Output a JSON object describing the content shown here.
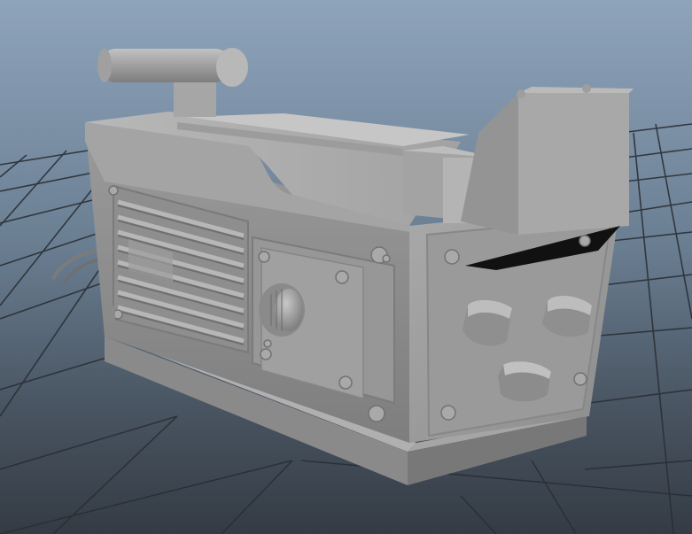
{
  "viewport": {
    "background_top": "#8ea4bb",
    "background_bottom": "#343b44",
    "grid_color": "#2a2f35"
  },
  "model": {
    "material_color": "#9a9a9a",
    "shadow_color": "#5e5e5e",
    "highlight_color": "#bdbdbd",
    "vent_slat_count": 8,
    "screw_count": 14,
    "knob_count": 4
  }
}
